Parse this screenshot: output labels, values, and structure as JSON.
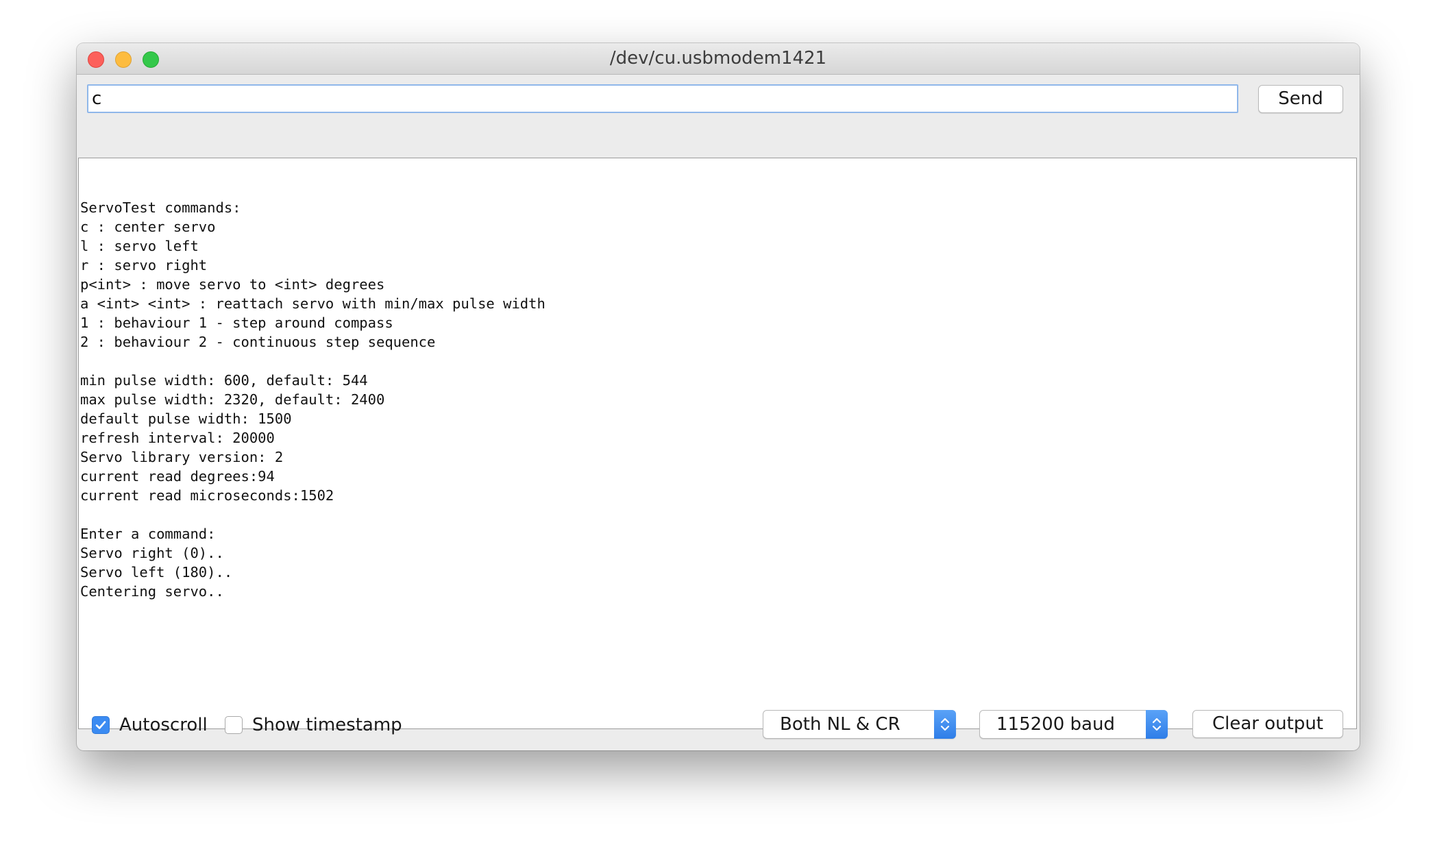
{
  "window": {
    "title": "/dev/cu.usbmodem1421"
  },
  "input": {
    "value": "c"
  },
  "send_label": "Send",
  "output_lines": [
    "ServoTest commands:",
    "c : center servo",
    "l : servo left",
    "r : servo right",
    "p<int> : move servo to <int> degrees",
    "a <int> <int> : reattach servo with min/max pulse width",
    "1 : behaviour 1 - step around compass",
    "2 : behaviour 2 - continuous step sequence",
    "",
    "min pulse width: 600, default: 544",
    "max pulse width: 2320, default: 2400",
    "default pulse width: 1500",
    "refresh interval: 20000",
    "Servo library version: 2",
    "current read degrees:94",
    "current read microseconds:1502",
    "",
    "Enter a command:",
    "Servo right (0)..",
    "Servo left (180)..",
    "Centering servo.."
  ],
  "footer": {
    "autoscroll_label": "Autoscroll",
    "autoscroll_checked": true,
    "timestamp_label": "Show timestamp",
    "timestamp_checked": false,
    "line_ending": "Both NL & CR",
    "baud_rate": "115200 baud",
    "clear_label": "Clear output"
  },
  "colors": {
    "accent": "#3b8bf2",
    "close": "#fc605b",
    "minimize": "#fdbc40",
    "maximize": "#34c84a"
  },
  "icons": {
    "close": "close-icon",
    "minimize": "minimize-icon",
    "maximize": "maximize-icon",
    "checkmark": "checkmark-icon",
    "select_stepper": "up-down-chevron-icon"
  }
}
